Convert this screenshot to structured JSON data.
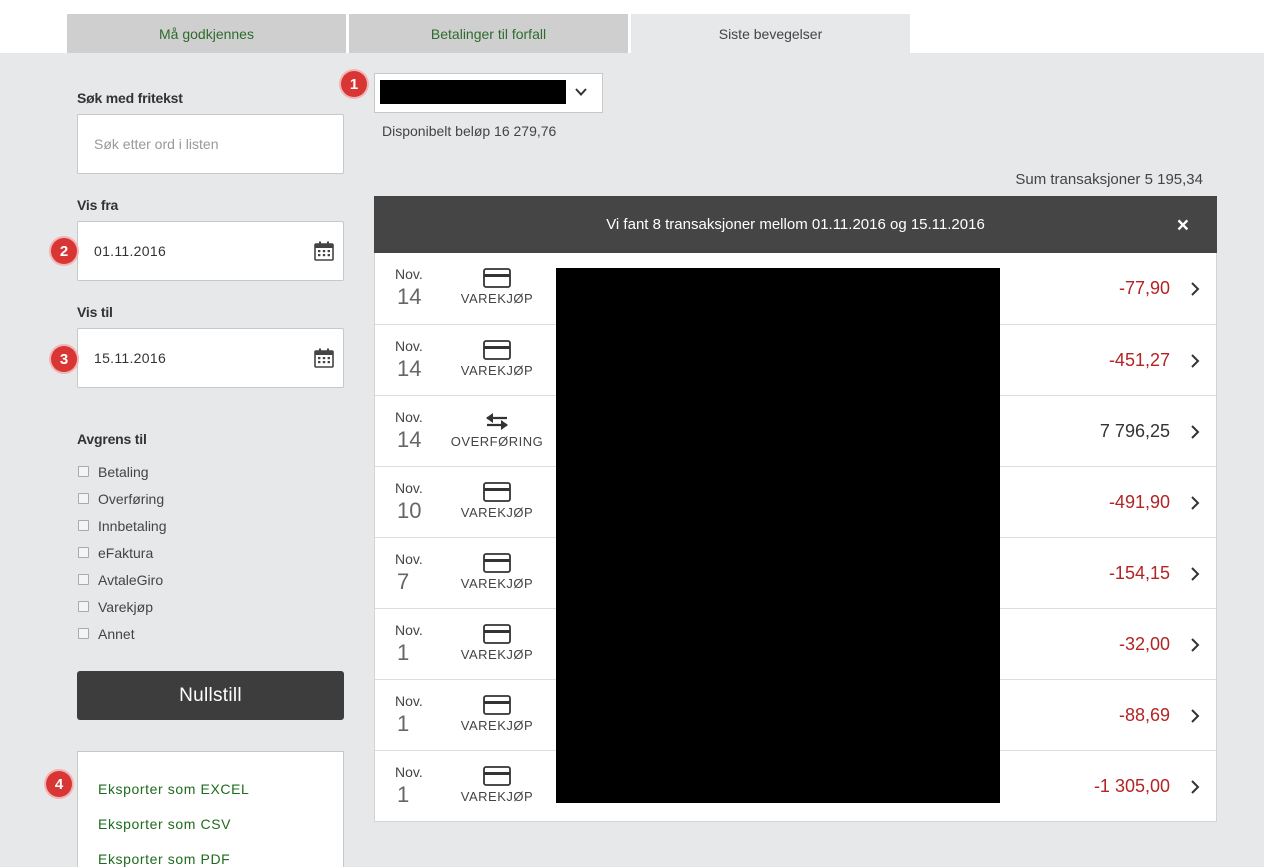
{
  "tabs": [
    {
      "label": "Må godkjennes"
    },
    {
      "label": "Betalinger til forfall"
    },
    {
      "label": "Siste bevegelser"
    }
  ],
  "markers": [
    "1",
    "2",
    "3",
    "4"
  ],
  "search": {
    "label": "Søk med fritekst",
    "placeholder": "Søk etter ord i listen"
  },
  "from": {
    "label": "Vis fra",
    "value": "01.11.2016"
  },
  "to": {
    "label": "Vis til",
    "value": "15.11.2016"
  },
  "filters": {
    "title": "Avgrens til",
    "items": [
      "Betaling",
      "Overføring",
      "Innbetaling",
      "eFaktura",
      "AvtaleGiro",
      "Varekjøp",
      "Annet"
    ]
  },
  "reset_label": "Nullstill",
  "export": {
    "excel": "Eksporter som EXCEL",
    "csv": "Eksporter som CSV",
    "pdf": "Eksporter som PDF"
  },
  "account": {
    "available": "Disponibelt beløp 16 279,76"
  },
  "summary": "Sum transaksjoner 5 195,34",
  "banner": {
    "text": "Vi fant 8 transaksjoner mellom 01.11.2016 og 15.11.2016",
    "close": "×"
  },
  "transactions": [
    {
      "month": "Nov.",
      "day": "14",
      "type": "VAREKJØP",
      "icon": "card-icon",
      "amount": "-77,90"
    },
    {
      "month": "Nov.",
      "day": "14",
      "type": "VAREKJØP",
      "icon": "card-icon",
      "amount": "-451,27"
    },
    {
      "month": "Nov.",
      "day": "14",
      "type": "OVERFØRING",
      "icon": "transfer-icon",
      "amount": "7 796,25"
    },
    {
      "month": "Nov.",
      "day": "10",
      "type": "VAREKJØP",
      "icon": "card-icon",
      "amount": "-491,90"
    },
    {
      "month": "Nov.",
      "day": "7",
      "type": "VAREKJØP",
      "icon": "card-icon",
      "amount": "-154,15"
    },
    {
      "month": "Nov.",
      "day": "1",
      "type": "VAREKJØP",
      "icon": "card-icon",
      "amount": "-32,00"
    },
    {
      "month": "Nov.",
      "day": "1",
      "type": "VAREKJØP",
      "icon": "card-icon",
      "amount": "-88,69"
    },
    {
      "month": "Nov.",
      "day": "1",
      "type": "VAREKJØP",
      "icon": "card-icon",
      "amount": "-1 305,00"
    }
  ],
  "colors": {
    "negative": "#b32424",
    "link": "#1e6b1e",
    "marker": "#d83535",
    "banner": "#454545"
  }
}
